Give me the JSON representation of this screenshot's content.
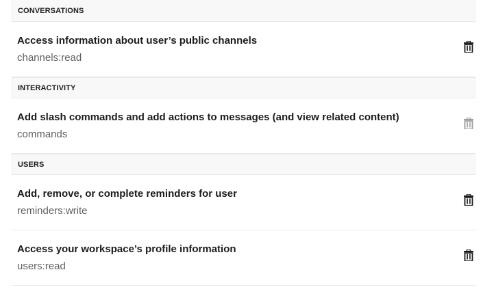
{
  "sections": [
    {
      "header": "CONVERSATIONS",
      "scopes": [
        {
          "title": "Access information about user’s public channels",
          "code": "channels:read",
          "deletable": true
        }
      ]
    },
    {
      "header": "INTERACTIVITY",
      "scopes": [
        {
          "title": "Add slash commands and add actions to messages (and view related content)",
          "code": "commands",
          "deletable": false
        }
      ]
    },
    {
      "header": "USERS",
      "scopes": [
        {
          "title": "Add, remove, or complete reminders for user",
          "code": "reminders:write",
          "deletable": true
        },
        {
          "title": "Access your workspace’s profile information",
          "code": "users:read",
          "deletable": true
        }
      ]
    }
  ],
  "icons": {
    "delete": "trash-icon"
  },
  "colors": {
    "icon_enabled": "#1d1c1d",
    "icon_disabled": "#9e9e9e"
  }
}
